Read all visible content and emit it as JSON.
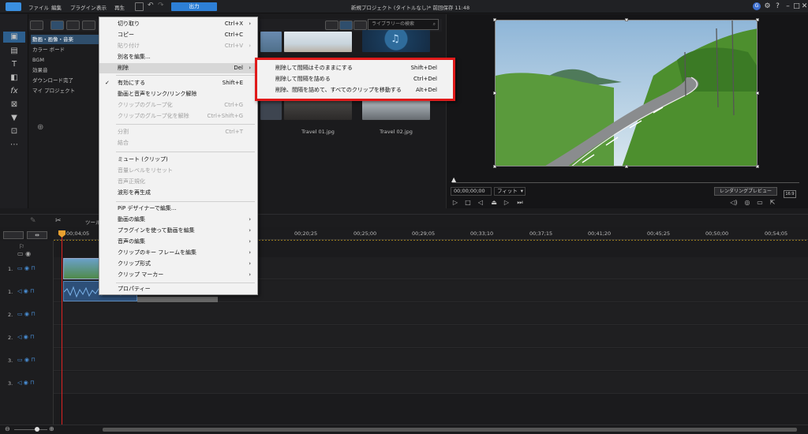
{
  "menubar": {
    "items": [
      "ファイル",
      "編集",
      "プラグイン",
      "表示",
      "再生"
    ],
    "output_button": "出力",
    "doc_title": "新規プロジェクト (タイトルなし)* 前回保存 11:48",
    "user_initial": "G"
  },
  "library": {
    "categories": [
      "動画・画像・音楽",
      "カラー ボード",
      "BGM",
      "効果音",
      "ダウンロード完了",
      "マイ プロジェクト"
    ],
    "search_placeholder": "ライブラリーの検索",
    "thumb_captions": [
      "Travel 01.jpg",
      "Travel 02.jpg"
    ]
  },
  "context_menu": {
    "items": [
      {
        "label": "切り取り",
        "shortcut": "Ctrl+X",
        "submenu": true
      },
      {
        "label": "コピー",
        "shortcut": "Ctrl+C"
      },
      {
        "label": "貼り付け",
        "shortcut": "Ctrl+V",
        "submenu": true,
        "disabled": true
      },
      {
        "label": "別名を編集..."
      },
      {
        "label": "削除",
        "shortcut": "Del",
        "submenu": true,
        "highlight": true
      },
      {
        "label": "有効にする",
        "shortcut": "Shift+E",
        "checked": true
      },
      {
        "label": "動画と音声をリンク/リンク解除"
      },
      {
        "label": "クリップのグループ化",
        "shortcut": "Ctrl+G",
        "disabled": true
      },
      {
        "label": "クリップのグループ化を解除",
        "shortcut": "Ctrl+Shift+G",
        "disabled": true
      },
      {
        "label": "分割",
        "shortcut": "Ctrl+T",
        "disabled": true
      },
      {
        "label": "結合",
        "disabled": true
      },
      {
        "label": "ミュート (クリップ)"
      },
      {
        "label": "音量レベルをリセット",
        "disabled": true
      },
      {
        "label": "音声正規化",
        "disabled": true
      },
      {
        "label": "波形を再生成"
      },
      {
        "label": "PiP デザイナーで編集..."
      },
      {
        "label": "動画の編集",
        "submenu": true
      },
      {
        "label": "プラグインを使って動画を編集",
        "submenu": true
      },
      {
        "label": "音声の編集",
        "submenu": true
      },
      {
        "label": "クリップのキー フレームを編集",
        "submenu": true
      },
      {
        "label": "クリップ形式",
        "submenu": true
      },
      {
        "label": "クリップ マーカー",
        "submenu": true
      },
      {
        "label": "プロパティー"
      }
    ]
  },
  "delete_submenu": {
    "items": [
      {
        "label": "削除して間隔はそのままにする",
        "shortcut": "Shift+Del"
      },
      {
        "label": "削除して間隔を詰める",
        "shortcut": "Ctrl+Del"
      },
      {
        "label": "削除、間隔を詰めて、すべてのクリップを移動する",
        "shortcut": "Alt+Del"
      }
    ]
  },
  "preview": {
    "timecode": "00;00;00;00",
    "fit_label": "フィット",
    "render_preview": "レンダリングプレビュー",
    "zoom_label": "16:9"
  },
  "timeline": {
    "tool_label": "ツール",
    "ruler_ticks": [
      "00;04;05",
      "00;20;25",
      "00;25;00",
      "00;29;05",
      "00;33;10",
      "00;37;15",
      "00;41;20",
      "00;45;25",
      "00;50;00",
      "00;54;05"
    ],
    "tracks": [
      "1.",
      "1.",
      "2.",
      "2.",
      "3.",
      "3."
    ]
  },
  "colors": {
    "accent": "#2d7fd6",
    "highlight_box": "#e01b1b",
    "playhead": "#dd2222"
  }
}
